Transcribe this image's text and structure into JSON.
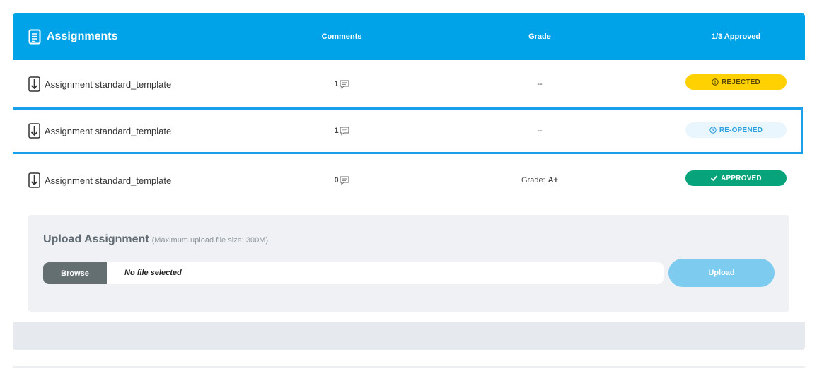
{
  "header": {
    "title": "Assignments",
    "col_comments": "Comments",
    "col_grade": "Grade",
    "col_status": "1/3 Approved",
    "icon": "document-icon"
  },
  "rows": [
    {
      "name": "Assignment standard_template",
      "comments": "1",
      "grade": "--",
      "grade_value": "",
      "status": "REJECTED",
      "status_icon": "alert-icon",
      "status_color": "#ffd100"
    },
    {
      "name": "Assignment standard_template",
      "comments": "1",
      "grade": "--",
      "grade_value": "",
      "status": "RE-OPENED",
      "status_icon": "clock-icon",
      "status_color": "#eaf6fd"
    },
    {
      "name": "Assignment standard_template",
      "comments": "0",
      "grade": "Grade:",
      "grade_value": "A+",
      "status": "APPROVED",
      "status_icon": "check-icon",
      "status_color": "#07a37b"
    }
  ],
  "upload": {
    "title": "Upload Assignment",
    "note": "(Maximum upload file size: 300M)",
    "browse_label": "Browse",
    "file_name": "No file selected",
    "upload_label": "Upload"
  },
  "colors": {
    "header_bg": "#00a3e8",
    "selected_border": "#1aa0ea"
  }
}
